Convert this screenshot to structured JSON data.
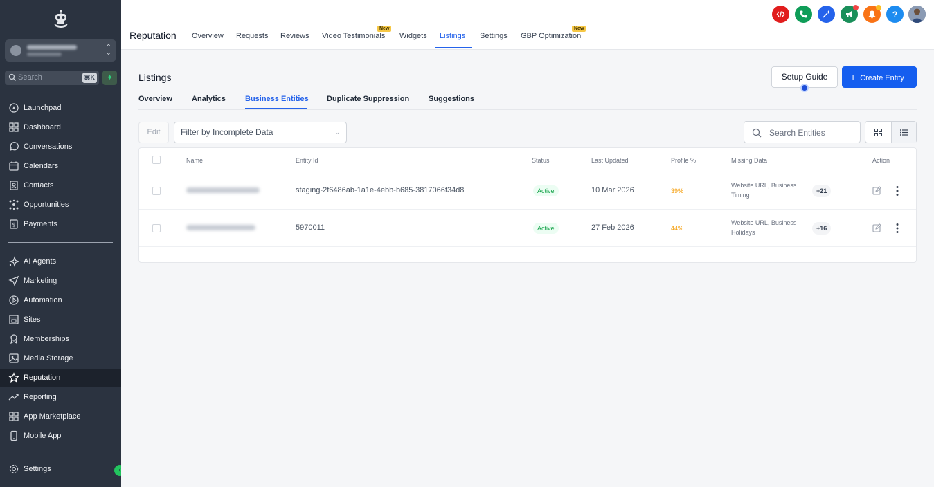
{
  "sidebar": {
    "search_placeholder": "Search",
    "search_shortcut": "⌘K",
    "nav_top": [
      {
        "label": "Launchpad",
        "icon": "launchpad-icon"
      },
      {
        "label": "Dashboard",
        "icon": "dashboard-icon"
      },
      {
        "label": "Conversations",
        "icon": "chat-bubble-icon"
      },
      {
        "label": "Calendars",
        "icon": "calendar-icon"
      },
      {
        "label": "Contacts",
        "icon": "contacts-icon"
      },
      {
        "label": "Opportunities",
        "icon": "opportunities-icon"
      },
      {
        "label": "Payments",
        "icon": "payments-icon"
      }
    ],
    "nav_bottom": [
      {
        "label": "AI Agents",
        "icon": "sparkle-icon"
      },
      {
        "label": "Marketing",
        "icon": "send-icon"
      },
      {
        "label": "Automation",
        "icon": "automation-icon"
      },
      {
        "label": "Sites",
        "icon": "sites-icon"
      },
      {
        "label": "Memberships",
        "icon": "memberships-icon"
      },
      {
        "label": "Media Storage",
        "icon": "image-icon"
      },
      {
        "label": "Reputation",
        "icon": "star-icon",
        "active": true
      },
      {
        "label": "Reporting",
        "icon": "trend-icon"
      },
      {
        "label": "App Marketplace",
        "icon": "grid-icon"
      },
      {
        "label": "Mobile App",
        "icon": "phone-icon"
      }
    ],
    "settings_label": "Settings"
  },
  "header": {
    "title": "Reputation",
    "tabs": [
      {
        "label": "Overview"
      },
      {
        "label": "Requests"
      },
      {
        "label": "Reviews"
      },
      {
        "label": "Video Testimonials",
        "badge": "New"
      },
      {
        "label": "Widgets"
      },
      {
        "label": "Listings",
        "active": true
      },
      {
        "label": "Settings"
      },
      {
        "label": "GBP Optimization",
        "badge": "New"
      }
    ],
    "icons": [
      {
        "name": "code-icon",
        "color": "#e11d1d"
      },
      {
        "name": "phone-call-icon",
        "color": "#0f9d58"
      },
      {
        "name": "magic-icon",
        "color": "#2563eb"
      },
      {
        "name": "megaphone-icon",
        "color": "#1a8f5a"
      },
      {
        "name": "bell-icon",
        "color": "#f97316"
      },
      {
        "name": "help-icon",
        "color": "#1d8cf0"
      }
    ],
    "help_glyph": "?"
  },
  "page": {
    "title": "Listings",
    "setup_guide_label": "Setup Guide",
    "create_entity_label": "Create Entity",
    "sub_tabs": [
      {
        "label": "Overview"
      },
      {
        "label": "Analytics"
      },
      {
        "label": "Business Entities",
        "active": true
      },
      {
        "label": "Duplicate Suppression"
      },
      {
        "label": "Suggestions"
      }
    ],
    "edit_label": "Edit",
    "filter_placeholder": "Filter by Incomplete Data",
    "search_placeholder": "Search Entities"
  },
  "table": {
    "columns": [
      "Name",
      "Entity Id",
      "Status",
      "Last Updated",
      "Profile %",
      "Missing Data",
      "Action"
    ],
    "rows": [
      {
        "entity_id": "staging-2f6486ab-1a1e-4ebb-b685-3817066f34d8",
        "status": "Active",
        "last_updated": "10 Mar 2026",
        "profile_pct": "39%",
        "missing_line1": "Website URL, Business",
        "missing_line2": "Timing",
        "more": "+21"
      },
      {
        "entity_id": "5970011",
        "status": "Active",
        "last_updated": "27 Feb 2026",
        "profile_pct": "44%",
        "missing_line1": "Website URL, Business",
        "missing_line2": "Holidays",
        "more": "+16"
      }
    ]
  },
  "colors": {
    "sidebar_bg": "#2b3340",
    "accent": "#155eef",
    "active_status": "#16a34a",
    "profile_pct": "#f59e0b",
    "new_badge": "#f6c744"
  }
}
